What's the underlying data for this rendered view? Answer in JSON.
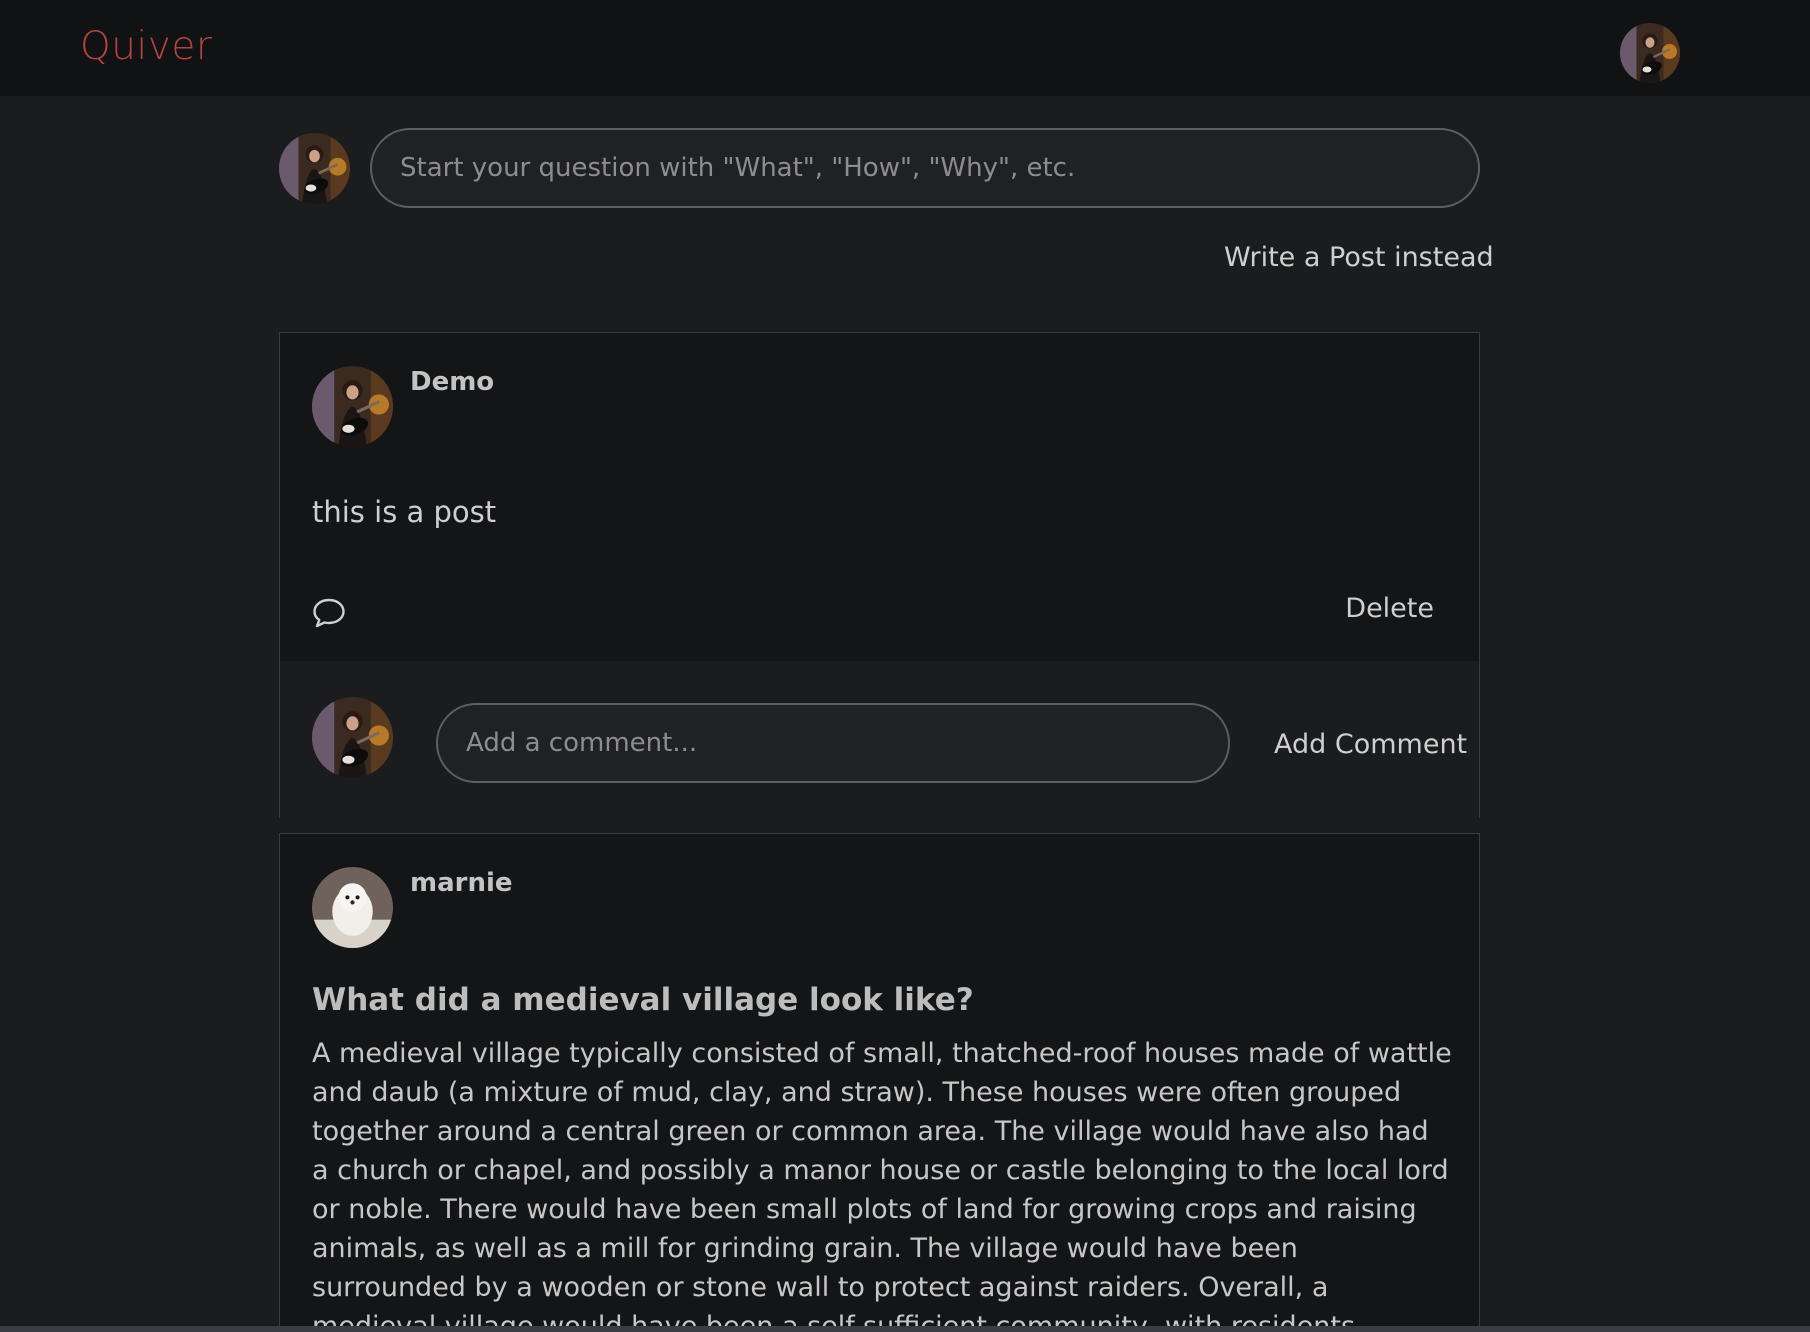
{
  "app": {
    "logo": "Quiver"
  },
  "ask": {
    "placeholder": "Start your question with \"What\", \"How\", \"Why\", etc.",
    "write_post_label": "Write a Post instead"
  },
  "posts": [
    {
      "author": "Demo",
      "body": "this is a post",
      "delete_label": "Delete",
      "comment_placeholder": "Add a comment...",
      "add_comment_label": "Add Comment"
    },
    {
      "author": "marnie",
      "title": "What did a medieval village look like?",
      "answer": "A medieval village typically consisted of small, thatched-roof houses made of wattle and daub (a mixture of mud, clay, and straw). These houses were often grouped together around a central green or common area. The village would have also had a church or chapel, and possibly a manor house or castle belonging to the local lord or noble. There would have been small plots of land for growing crops and raising animals, as well as a mill for grinding grain. The village would have been surrounded by a wooden or stone wall to protect against raiders. Overall, a medieval village would have been a self-sufficient community, with residents working together to farm, trade and defend their"
    }
  ],
  "icons": {
    "comment": "speech-bubble-icon",
    "user_avatar": "user-avatar-guitarist",
    "marnie_avatar": "user-avatar-dog"
  },
  "colors": {
    "accent": "#b2443e",
    "background": "#1b1c1e",
    "topbar": "#111214",
    "card": "#141517"
  }
}
